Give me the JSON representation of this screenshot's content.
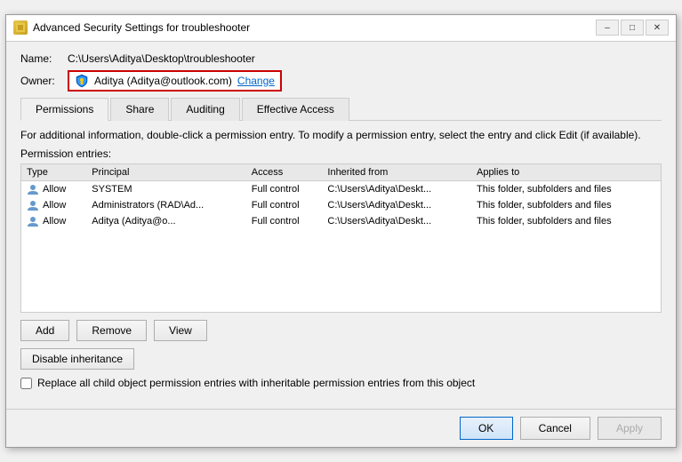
{
  "window": {
    "title": "Advanced Security Settings for troubleshooter",
    "min_label": "–",
    "max_label": "□",
    "close_label": "✕"
  },
  "fields": {
    "name_label": "Name:",
    "name_value": "C:\\Users\\Aditya\\Desktop\\troubleshooter",
    "owner_label": "Owner:",
    "owner_value": "Aditya (Aditya@outlook.com)",
    "change_label": "Change"
  },
  "tabs": [
    {
      "id": "permissions",
      "label": "Permissions",
      "active": true
    },
    {
      "id": "share",
      "label": "Share",
      "active": false
    },
    {
      "id": "auditing",
      "label": "Auditing",
      "active": false
    },
    {
      "id": "effective-access",
      "label": "Effective Access",
      "active": false
    }
  ],
  "info_text": "For additional information, double-click a permission entry. To modify a permission entry, select the entry and click Edit (if available).",
  "permission_entries_label": "Permission entries:",
  "table": {
    "headers": [
      "Type",
      "Principal",
      "Access",
      "Inherited from",
      "Applies to"
    ],
    "rows": [
      {
        "type": "Allow",
        "principal": "SYSTEM",
        "access": "Full control",
        "inherited_from": "C:\\Users\\Aditya\\Deskt...",
        "applies_to": "This folder, subfolders and files"
      },
      {
        "type": "Allow",
        "principal": "Administrators (RAD\\Ad...",
        "access": "Full control",
        "inherited_from": "C:\\Users\\Aditya\\Deskt...",
        "applies_to": "This folder, subfolders and files"
      },
      {
        "type": "Allow",
        "principal": "Aditya (Aditya@o...",
        "access": "Full control",
        "inherited_from": "C:\\Users\\Aditya\\Deskt...",
        "applies_to": "This folder, subfolders and files"
      }
    ]
  },
  "buttons": {
    "add": "Add",
    "remove": "Remove",
    "view": "View",
    "disable_inheritance": "Disable inheritance"
  },
  "checkbox": {
    "label": "Replace all child object permission entries with inheritable permission entries from this object"
  },
  "footer": {
    "ok": "OK",
    "cancel": "Cancel",
    "apply": "Apply"
  }
}
